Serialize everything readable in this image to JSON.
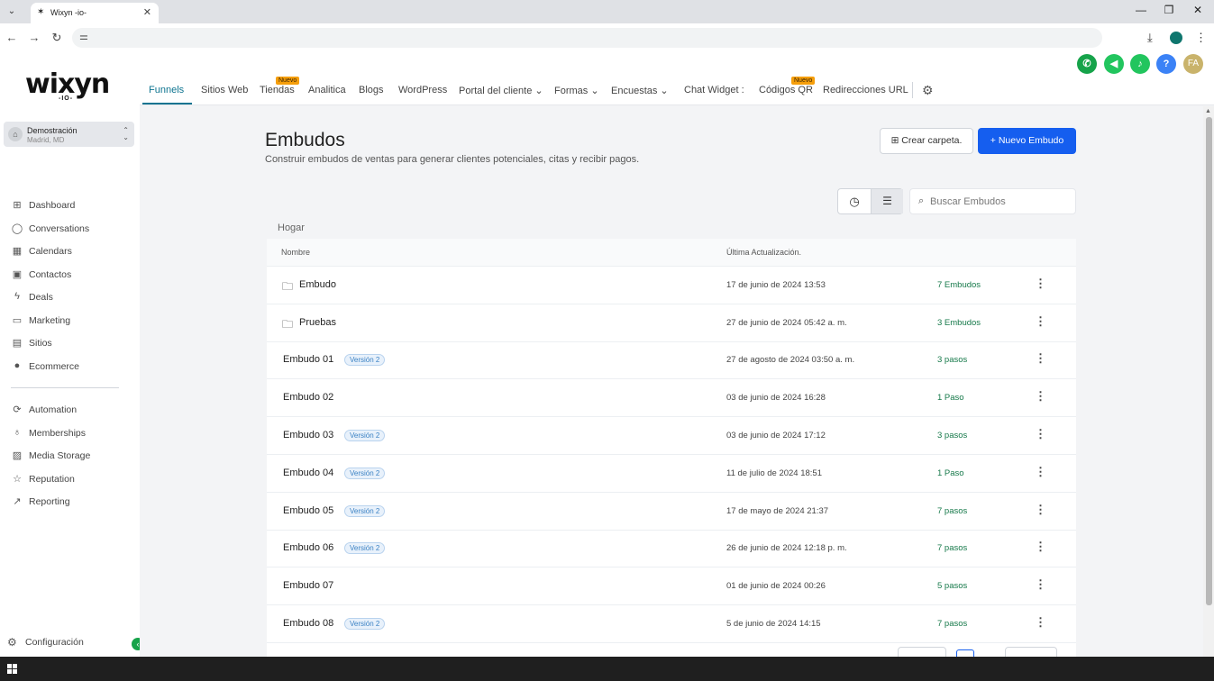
{
  "browser": {
    "tab_title": "Wixyn -io-",
    "tab_close": "✕",
    "tab_menu": "⌄",
    "site_info": "⚌"
  },
  "sidebar": {
    "logo": "wixyn",
    "logo_sub": "-IO-",
    "account_name": "Demostración",
    "account_location": "Madrid, MD",
    "items": [
      {
        "label": "Dashboard",
        "icon": "⊞"
      },
      {
        "label": "Conversations",
        "icon": "◯"
      },
      {
        "label": "Calendars",
        "icon": "▦"
      },
      {
        "label": "Contactos",
        "icon": "▣"
      },
      {
        "label": "Deals",
        "icon": "ϟ"
      },
      {
        "label": "Marketing",
        "icon": "▭"
      },
      {
        "label": "Sitios",
        "icon": "▤"
      },
      {
        "label": "Ecommerce",
        "icon": "●"
      }
    ],
    "items2": [
      {
        "label": "Automation",
        "icon": "⟳"
      },
      {
        "label": "Memberships",
        "icon": "♁"
      },
      {
        "label": "Media Storage",
        "icon": "▨"
      },
      {
        "label": "Reputation",
        "icon": "☆"
      },
      {
        "label": "Reporting",
        "icon": "↗"
      }
    ],
    "config_label": "Configuración",
    "collapse": "‹"
  },
  "topnav": {
    "items": [
      {
        "label": "Funnels",
        "active": true
      },
      {
        "label": "Sitios Web"
      },
      {
        "label": "Tiendas",
        "badge": "Nuevo"
      },
      {
        "label": "Analitica"
      },
      {
        "label": "Blogs"
      },
      {
        "label": "WordPress"
      },
      {
        "label": "Portal del cliente ⌄"
      },
      {
        "label": "Formas ⌄"
      },
      {
        "label": "Encuestas ⌄"
      },
      {
        "label": "Chat Widget :"
      },
      {
        "label": "Códigos QR",
        "badge": "Nuevo"
      },
      {
        "label": "Redirecciones URL"
      }
    ],
    "user_initials": "FA",
    "help": "?"
  },
  "main": {
    "title": "Embudos",
    "subtitle": "Construir embudos de ventas para generar clientes potenciales, citas y recibir pagos.",
    "btn_folder": "Crear carpeta.",
    "btn_new": "+  Nuevo Embudo",
    "search_placeholder": "Buscar Embudos",
    "breadcrumb": "Hogar",
    "col_name": "Nombre",
    "col_updated": "Última Actualización.",
    "rows": [
      {
        "name": "Embudo",
        "folder": true,
        "version": "",
        "date": "17 de junio de 2024 13:53",
        "count": "7 Embudos"
      },
      {
        "name": "Pruebas",
        "folder": true,
        "version": "",
        "date": "27 de junio de 2024 05:42 a. m.",
        "count": "3 Embudos"
      },
      {
        "name": "Embudo 01",
        "folder": false,
        "version": "Versión 2",
        "date": "27 de agosto de 2024 03:50 a. m.",
        "count": "3 pasos"
      },
      {
        "name": "Embudo 02",
        "folder": false,
        "version": "",
        "date": "03 de junio de 2024 16:28",
        "count": "1 Paso"
      },
      {
        "name": "Embudo 03",
        "folder": false,
        "version": "Versión 2",
        "date": "03 de junio de 2024 17:12",
        "count": "3 pasos"
      },
      {
        "name": "Embudo 04",
        "folder": false,
        "version": "Versión 2",
        "date": "11 de julio de 2024 18:51",
        "count": "1 Paso"
      },
      {
        "name": "Embudo 05",
        "folder": false,
        "version": "Versión 2",
        "date": "17 de mayo de 2024 21:37",
        "count": "7 pasos"
      },
      {
        "name": "Embudo 06",
        "folder": false,
        "version": "Versión 2",
        "date": "26 de junio de 2024 12:18 p. m.",
        "count": "7 pasos"
      },
      {
        "name": "Embudo 07",
        "folder": false,
        "version": "",
        "date": "01 de junio de 2024 00:26",
        "count": "5 pasos"
      },
      {
        "name": "Embudo 08",
        "folder": false,
        "version": "Versión 2",
        "date": "5 de junio de 2024 14:15",
        "count": "7 pasos"
      }
    ]
  },
  "colors": {
    "accent": "#155eef",
    "active_tab": "#0e7490",
    "count_green": "#16794a",
    "badge": "#f59e0b"
  }
}
